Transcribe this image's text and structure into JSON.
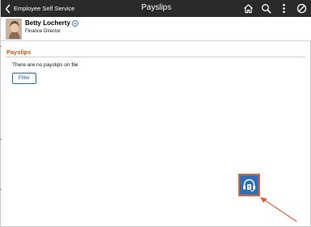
{
  "topbar": {
    "back_label": "Employee Self Service",
    "title": "Payslips",
    "icons": [
      "home-icon",
      "search-icon",
      "more-vertical-icon",
      "no-entry-icon"
    ]
  },
  "person": {
    "name": "Betty Locherty",
    "role": "Finance Director"
  },
  "section": {
    "title": "Payslips",
    "empty_message": "There are no payslips on file",
    "filter_label": "Filter"
  },
  "support": {
    "icon": "support-headset-icon"
  },
  "colors": {
    "topbar_bg": "#2a2a2a",
    "section_title": "#c25a10",
    "filter_border": "#1f6fb5",
    "support_bg": "#2f6fb4",
    "support_border": "#e0603a",
    "arrow": "#e0603a"
  }
}
